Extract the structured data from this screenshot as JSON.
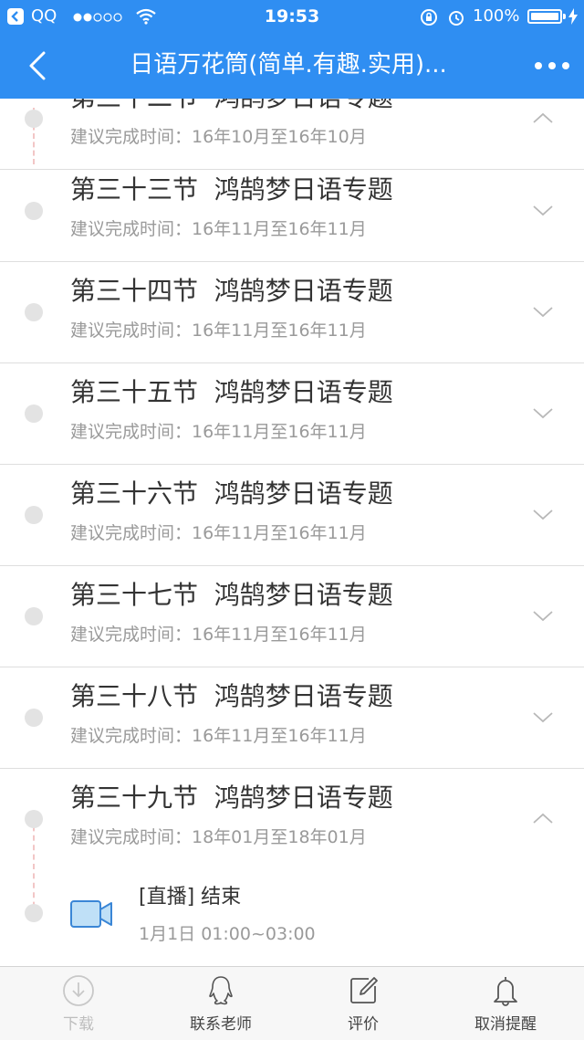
{
  "status_bar": {
    "carrier": "QQ",
    "time": "19:53",
    "battery": "100%"
  },
  "nav": {
    "title": "日语万花筒(简单.有趣.实用)..."
  },
  "lessons": [
    {
      "title": "第三十二节  鸿鹄梦日语专题",
      "subtitle": "建议完成时间：16年10月至16年10月",
      "expanded": true
    },
    {
      "title": "第三十三节  鸿鹄梦日语专题",
      "subtitle": "建议完成时间：16年11月至16年11月",
      "expanded": false
    },
    {
      "title": "第三十四节  鸿鹄梦日语专题",
      "subtitle": "建议完成时间：16年11月至16年11月",
      "expanded": false
    },
    {
      "title": "第三十五节  鸿鹄梦日语专题",
      "subtitle": "建议完成时间：16年11月至16年11月",
      "expanded": false
    },
    {
      "title": "第三十六节  鸿鹄梦日语专题",
      "subtitle": "建议完成时间：16年11月至16年11月",
      "expanded": false
    },
    {
      "title": "第三十七节  鸿鹄梦日语专题",
      "subtitle": "建议完成时间：16年11月至16年11月",
      "expanded": false
    },
    {
      "title": "第三十八节  鸿鹄梦日语专题",
      "subtitle": "建议完成时间：16年11月至16年11月",
      "expanded": false
    },
    {
      "title": "第三十九节  鸿鹄梦日语专题",
      "subtitle": "建议完成时间：18年01月至18年01月",
      "expanded": true
    }
  ],
  "live": {
    "title": "[直播] 结束",
    "time": "1月1日 01:00~03:00",
    "icon": "video-camera-icon"
  },
  "bottom_tabs": [
    {
      "label": "下载",
      "icon": "download-icon",
      "enabled": false
    },
    {
      "label": "联系老师",
      "icon": "qq-penguin-icon",
      "enabled": true
    },
    {
      "label": "评价",
      "icon": "edit-icon",
      "enabled": true
    },
    {
      "label": "取消提醒",
      "icon": "bell-icon",
      "enabled": true
    }
  ],
  "colors": {
    "header": "#2f8ef2",
    "video_icon_fill": "#bfe0f7",
    "video_icon_stroke": "#3a86d6"
  }
}
